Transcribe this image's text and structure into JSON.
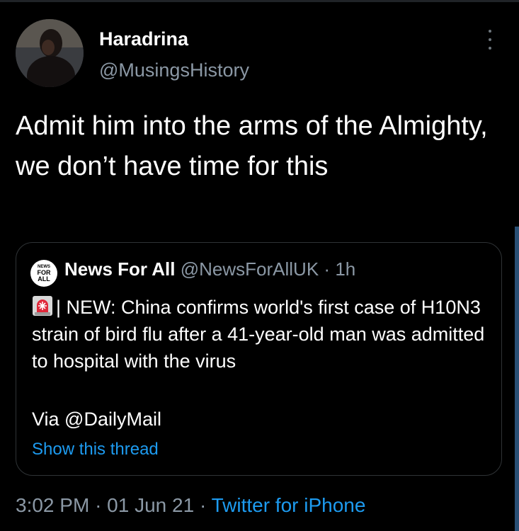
{
  "tweet": {
    "author": {
      "name": "Haradrina",
      "handle": "@MusingsHistory",
      "avatar_icon": "user-avatar"
    },
    "text": "Admit him into the arms of the Almighty, we don’t have time for this",
    "quoted": {
      "author_name": "News For All",
      "author_handle": "@NewsForAllUK",
      "separator": "·",
      "time_ago": "1h",
      "avatar_lines": [
        "NEWS",
        "FOR",
        "ALL"
      ],
      "emoji_icon": "rotating-light-icon",
      "text": "| NEW: China confirms world's first case of H10N3 strain of bird flu after a 41-year-old man was admitted to hospital with the virus",
      "via": "Via @DailyMail",
      "show_thread": "Show this thread"
    },
    "footer": {
      "time": "3:02 PM",
      "sep1": "·",
      "date": "01 Jun 21",
      "sep2": "·",
      "source": "Twitter for iPhone"
    }
  },
  "colors": {
    "background": "#000000",
    "text_primary": "#ffffff",
    "text_secondary": "#8b98a5",
    "link": "#1d9bf0",
    "border": "#2f3336"
  }
}
